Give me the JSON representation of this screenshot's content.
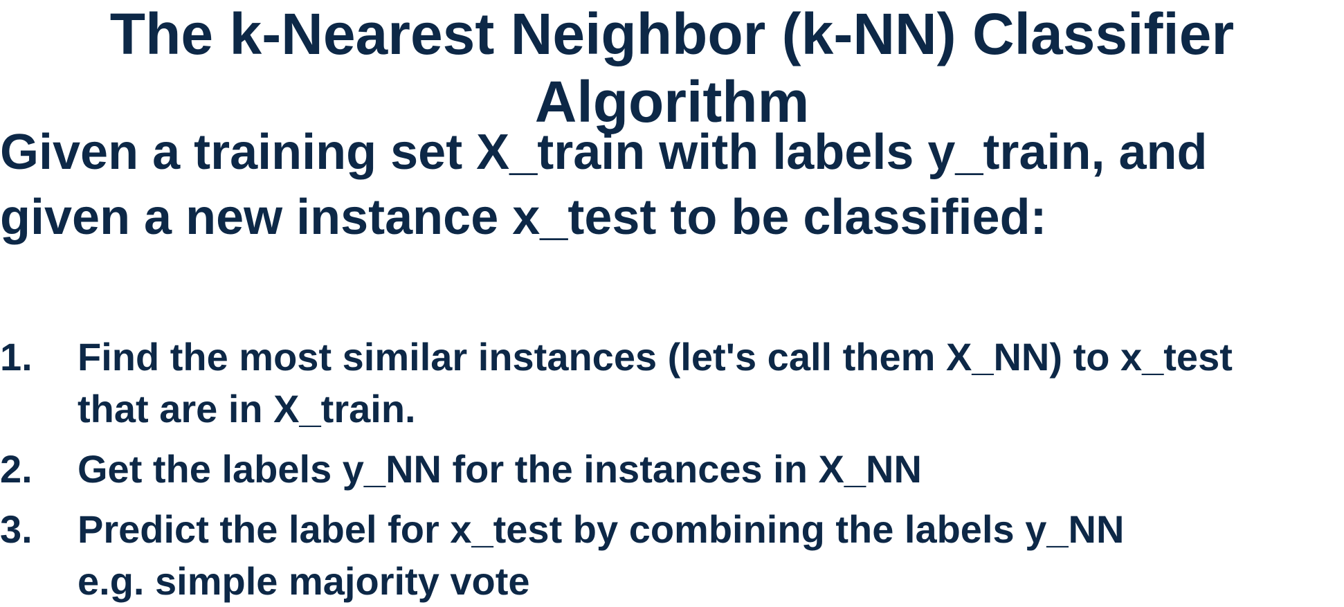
{
  "title": {
    "line1": "The k-Nearest Neighbor (k-NN) Classifier",
    "line2": "Algorithm"
  },
  "intro": {
    "line1": "Given a training set X_train with labels y_train, and",
    "line2": "given a new instance x_test to be classified:"
  },
  "steps": [
    {
      "number": "1.",
      "line1": "Find the most similar instances (let's call them X_NN) to x_test",
      "line2": "that are in X_train."
    },
    {
      "number": "2.",
      "line1": "Get the labels y_NN for the instances in X_NN"
    },
    {
      "number": "3.",
      "line1": "Predict the label for x_test by combining the labels y_NN",
      "line2": "e.g. simple majority vote"
    }
  ],
  "colors": {
    "text": "#0d2847",
    "background": "#ffffff"
  }
}
